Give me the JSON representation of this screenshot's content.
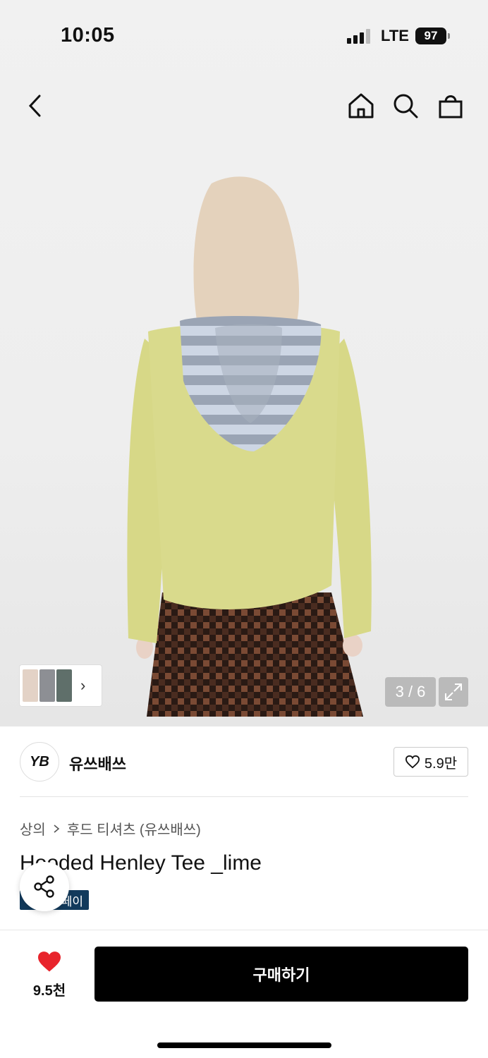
{
  "status_bar": {
    "time": "10:05",
    "network": "LTE",
    "battery": "97"
  },
  "nav": {
    "back_icon": "chevron-left-icon",
    "home_icon": "home-icon",
    "search_icon": "search-icon",
    "bag_icon": "shopping-bag-icon"
  },
  "gallery": {
    "counter": "3 / 6",
    "expand_icon": "expand-icon",
    "thumb_arrow": "›"
  },
  "brand": {
    "name": "유쓰배쓰",
    "logo_text": "YB",
    "likes": "5.9만"
  },
  "product": {
    "breadcrumb": [
      "상의",
      "후드 티셔츠 (유쓰배쓰)"
    ],
    "title": "Hooded Henley Tee _lime",
    "badge": "페이"
  },
  "bottom": {
    "wish_count": "9.5천",
    "buy_label": "구매하기"
  },
  "colors": {
    "accent_red": "#e8242c",
    "buy_button": "#000000",
    "badge_bg": "#123a5c"
  }
}
